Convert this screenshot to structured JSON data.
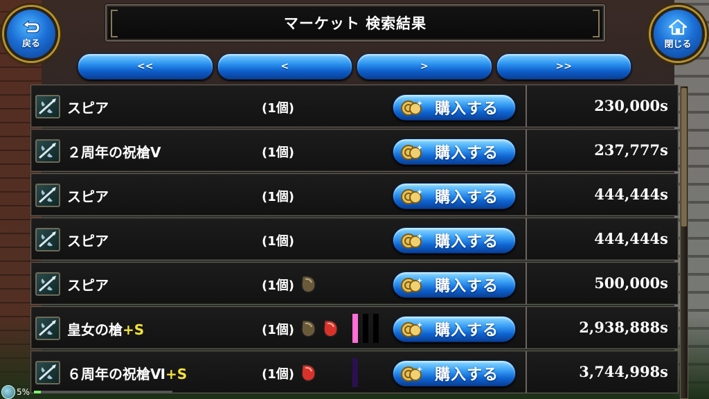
{
  "header": {
    "title": "マーケット 検索結果",
    "back_label": "戻る",
    "close_label": "閉じる"
  },
  "pagination": {
    "first": "<<",
    "prev": "<",
    "next": ">",
    "last": ">>"
  },
  "buy_label": "購入する",
  "items": [
    {
      "name": "スピア",
      "plus": "",
      "qty": "(1個)",
      "gems": [],
      "bars": [],
      "price": "230,000s"
    },
    {
      "name": "２周年の祝槍Ⅴ",
      "plus": "",
      "qty": "(1個)",
      "gems": [],
      "bars": [],
      "price": "237,777s"
    },
    {
      "name": "スピア",
      "plus": "",
      "qty": "(1個)",
      "gems": [],
      "bars": [],
      "price": "444,444s"
    },
    {
      "name": "スピア",
      "plus": "",
      "qty": "(1個)",
      "gems": [],
      "bars": [],
      "price": "444,444s"
    },
    {
      "name": "スピア",
      "plus": "",
      "qty": "(1個)",
      "gems": [
        "brown"
      ],
      "bars": [],
      "price": "500,000s"
    },
    {
      "name": "皇女の槍",
      "plus": "+S",
      "qty": "(1個)",
      "gems": [
        "brown",
        "red"
      ],
      "bars": [
        "#ff6fd8",
        "#000000",
        "#000000"
      ],
      "price": "2,938,888s"
    },
    {
      "name": "６周年の祝槍Ⅵ",
      "plus": "+S",
      "qty": "(1個)",
      "gems": [
        "red"
      ],
      "bars": [
        "#2a1050"
      ],
      "price": "3,744,998s"
    }
  ],
  "status": {
    "percent": "5%",
    "progress": 0.05
  },
  "colors": {
    "accent_blue": "#2b93f0",
    "plus_yellow": "#f2e23a",
    "gem_brown": "#6b5a3a",
    "gem_red": "#d8322a"
  }
}
